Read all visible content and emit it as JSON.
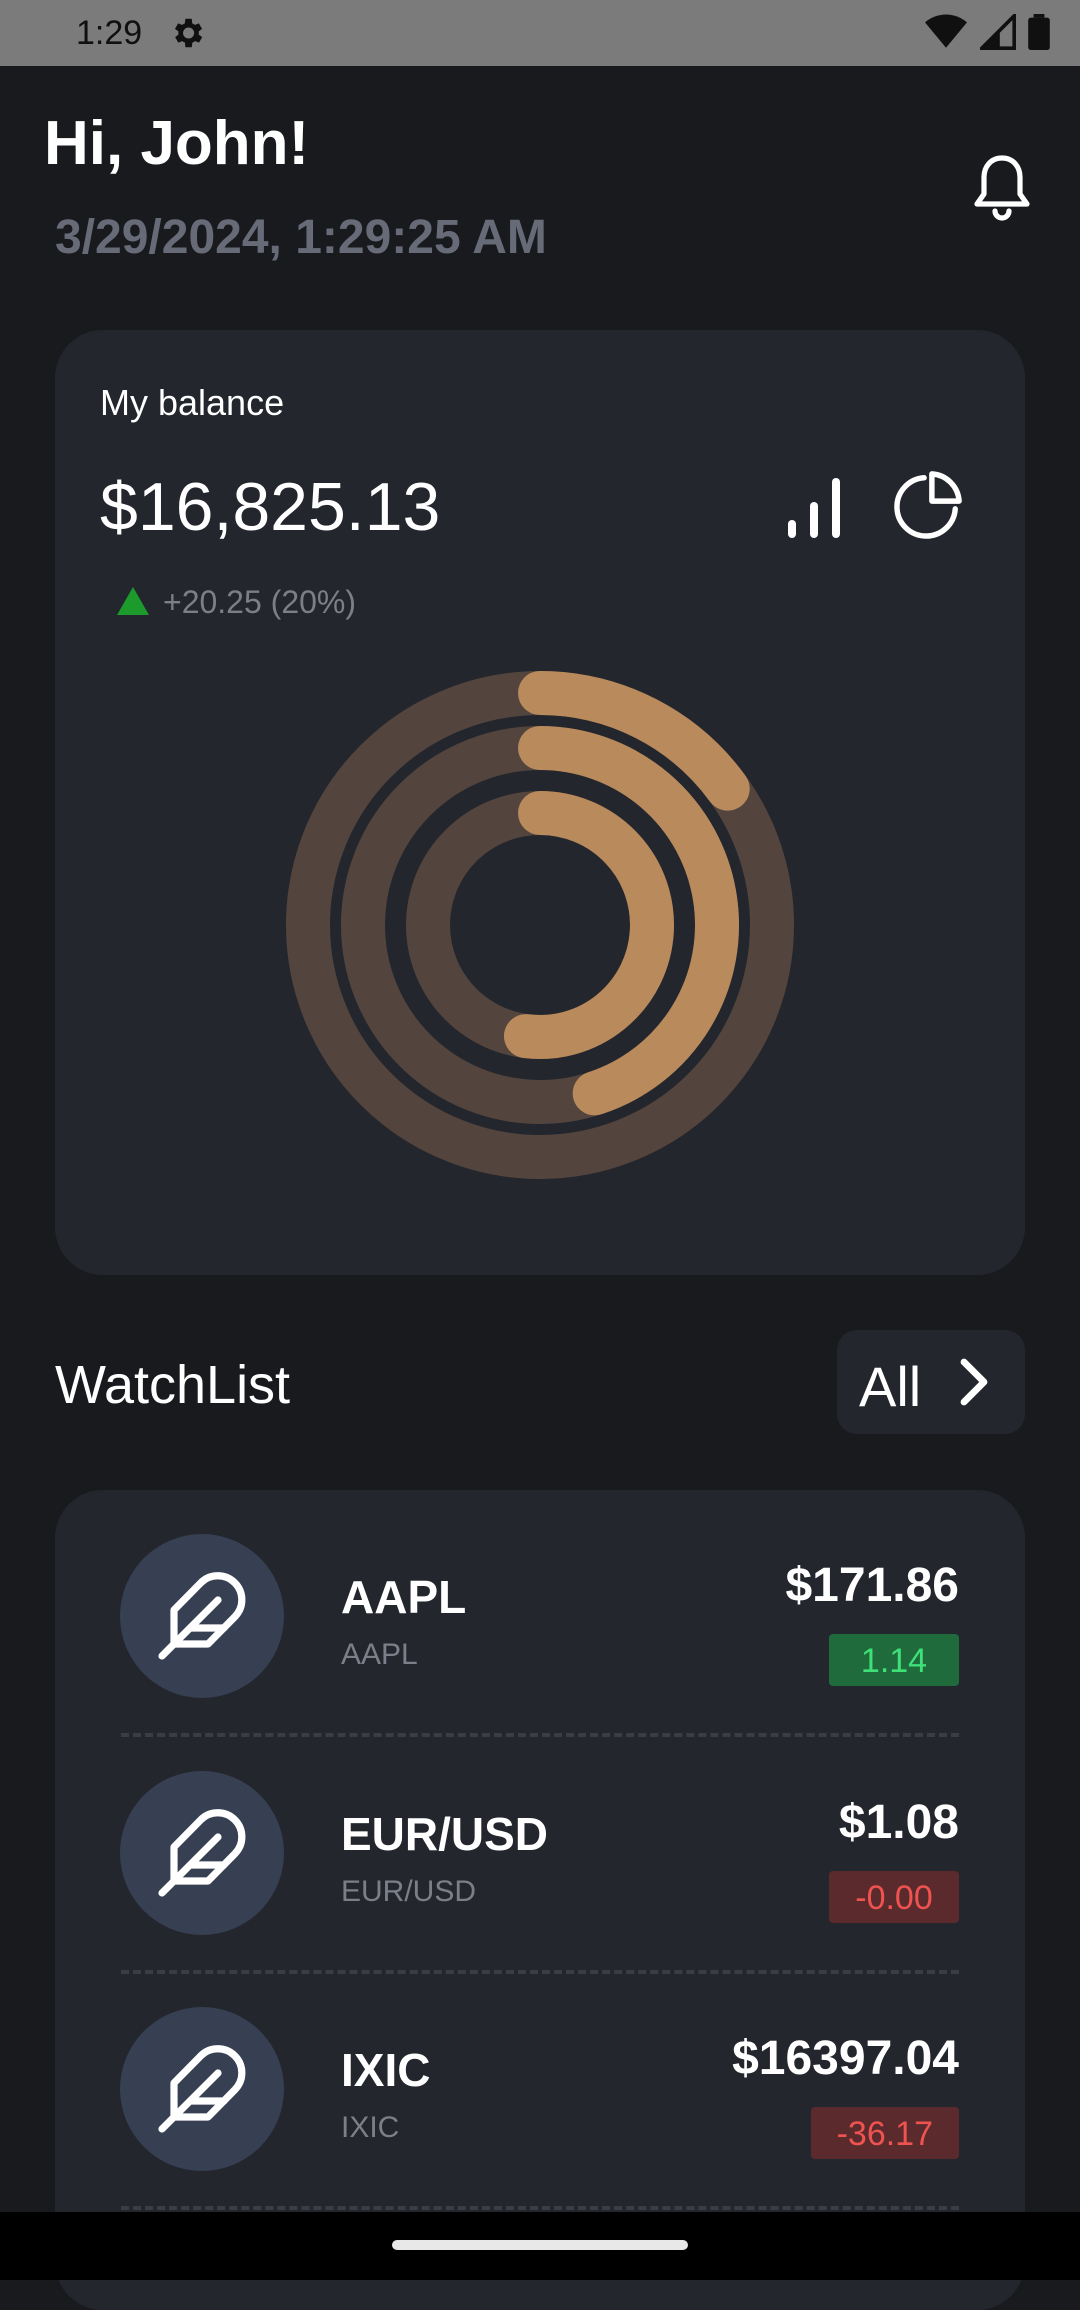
{
  "status_bar": {
    "time": "1:29",
    "icons": [
      "settings-icon",
      "wifi-icon",
      "signal-icon",
      "battery-icon"
    ]
  },
  "header": {
    "greeting": "Hi, John!",
    "datetime": "3/29/2024, 1:29:25 AM",
    "notification_icon": "bell-icon"
  },
  "balance": {
    "label": "My balance",
    "amount": "$16,825.13",
    "change": "+20.25 (20%)",
    "change_icon": "triangle-up-icon",
    "view_icons": [
      "bar-chart-icon",
      "pie-chart-icon"
    ]
  },
  "chart_data": {
    "type": "radial-progress",
    "series": [
      {
        "value": 0.15
      },
      {
        "value": 0.45
      },
      {
        "value": 0.52
      }
    ]
  },
  "watchlist": {
    "title": "WatchList",
    "all_label": "All",
    "items": [
      {
        "symbol": "AAPL",
        "name": "AAPL",
        "price": "$171.86",
        "change": "1.14",
        "direction": "up"
      },
      {
        "symbol": "EUR/USD",
        "name": "EUR/USD",
        "price": "$1.08",
        "change": "-0.00",
        "direction": "down"
      },
      {
        "symbol": "IXIC",
        "name": "IXIC",
        "price": "$16397.04",
        "change": "-36.17",
        "direction": "down"
      }
    ]
  },
  "colors": {
    "background": "#181a1e",
    "card": "#24262e",
    "accent": "#b98a5c",
    "up": "#3fe078",
    "down": "#ef5350",
    "muted": "#676b78"
  }
}
